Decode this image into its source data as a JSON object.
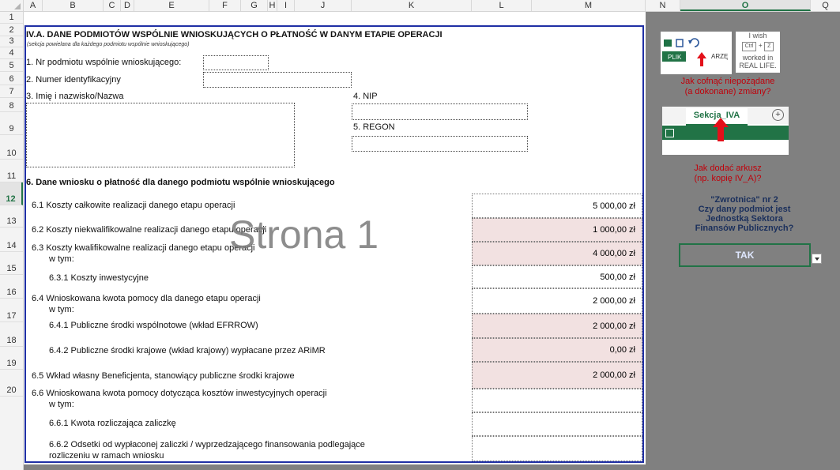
{
  "columns": [
    "A",
    "B",
    "C",
    "D",
    "E",
    "F",
    "G",
    "H",
    "I",
    "J",
    "K",
    "L",
    "M",
    "N",
    "O",
    "Q"
  ],
  "active_column": "O",
  "rows": [
    "1",
    "2",
    "3",
    "4",
    "5",
    "6",
    "7",
    "8",
    "9",
    "10",
    "11",
    "12",
    "13",
    "14",
    "15",
    "16",
    "17",
    "18",
    "19",
    "20"
  ],
  "active_row": "12",
  "form": {
    "title": "IV.A. DANE PODMIOTÓW WSPÓLNIE WNIOSKUJĄCYCH O PŁATNOŚĆ W DANYM ETAPIE OPERACJI",
    "subtitle": "(sekcja powielana dla każdego podmiotu wspólnie wnioskującego)",
    "field1_label": "1. Nr podmiotu wspólnie wnioskującego:",
    "field2_label": "2. Numer identyfikacyjny",
    "field3_label": "3. Imię i nazwisko/Nazwa",
    "field4_label": "4. NIP",
    "field5_label": "5. REGON",
    "section6_label": "6. Dane wniosku o płatność dla danego podmiotu wspólnie wnioskującego",
    "items": [
      {
        "label": "6.1 Koszty całkowite realizacji danego etapu operacji",
        "sub": "",
        "value": "5 000,00 zł"
      },
      {
        "label": "6.2 Koszty niekwalifikowalne realizacji danego etapu operacji",
        "sub": "",
        "value": "1 000,00 zł"
      },
      {
        "label": "6.3 Koszty kwalifikowalne realizacji danego etapu operacji",
        "sub": "w tym:",
        "value": "4 000,00 zł"
      },
      {
        "label": "6.3.1 Koszty inwestycyjne",
        "sub": "",
        "value": "500,00 zł"
      },
      {
        "label": "6.4 Wnioskowana kwota pomocy dla danego etapu operacji",
        "sub": "w tym:",
        "value": "2 000,00 zł"
      },
      {
        "label": "6.4.1 Publiczne  środki wspólnotowe (wkład EFRROW)",
        "sub": "",
        "value": "2 000,00 zł"
      },
      {
        "label": "6.4.2 Publiczne środki krajowe (wkład krajowy) wypłacane przez ARiMR",
        "sub": "",
        "value": "0,00 zł"
      },
      {
        "label": "6.5 Wkład własny Beneficjenta, stanowiący publiczne środki krajowe",
        "sub": "",
        "value": "2 000,00 zł"
      },
      {
        "label": "6.6 Wnioskowana kwota pomocy dotycząca kosztów inwestycyjnych operacji",
        "sub": "w tym:",
        "value": ""
      },
      {
        "label": "6.6.1 Kwota rozliczająca zaliczkę",
        "sub": "",
        "value": ""
      },
      {
        "label": "6.6.2 Odsetki od wypłaconej zaliczki / wyprzedzającego finansowania podlegające",
        "sub": "rozliczeniu w ramach wniosku",
        "value": ""
      }
    ]
  },
  "watermark": "Strona 1",
  "side_panel": {
    "ribbon_tab": "PLIK",
    "ribbon_tab2": "ARZĘ",
    "wish_lines": [
      "I wish",
      "Ctrl",
      "Z",
      "worked in",
      "REAL LIFE."
    ],
    "undo_note_line1": "Jak cofnąć niepożądane",
    "undo_note_line2": "(a dokonane) zmiany?",
    "sheet_tab_label": "Sekcja_IVA",
    "add_sheet_note_line1": "Jak dodać arkusz",
    "add_sheet_note_line2": "(np. kopię IV_A)?",
    "question_line1": "\"Zwrotnica\" nr 2",
    "question_line2": "Czy dany podmiot jest",
    "question_line3": "Jednostką Sektora",
    "question_line4": "Finansów Publicznych?",
    "answer": "TAK"
  },
  "colors": {
    "frame_border": "#1f2fa5",
    "pink_cell": "#f2e1e1",
    "red_note": "#c0000a",
    "excel_green": "#217346"
  }
}
